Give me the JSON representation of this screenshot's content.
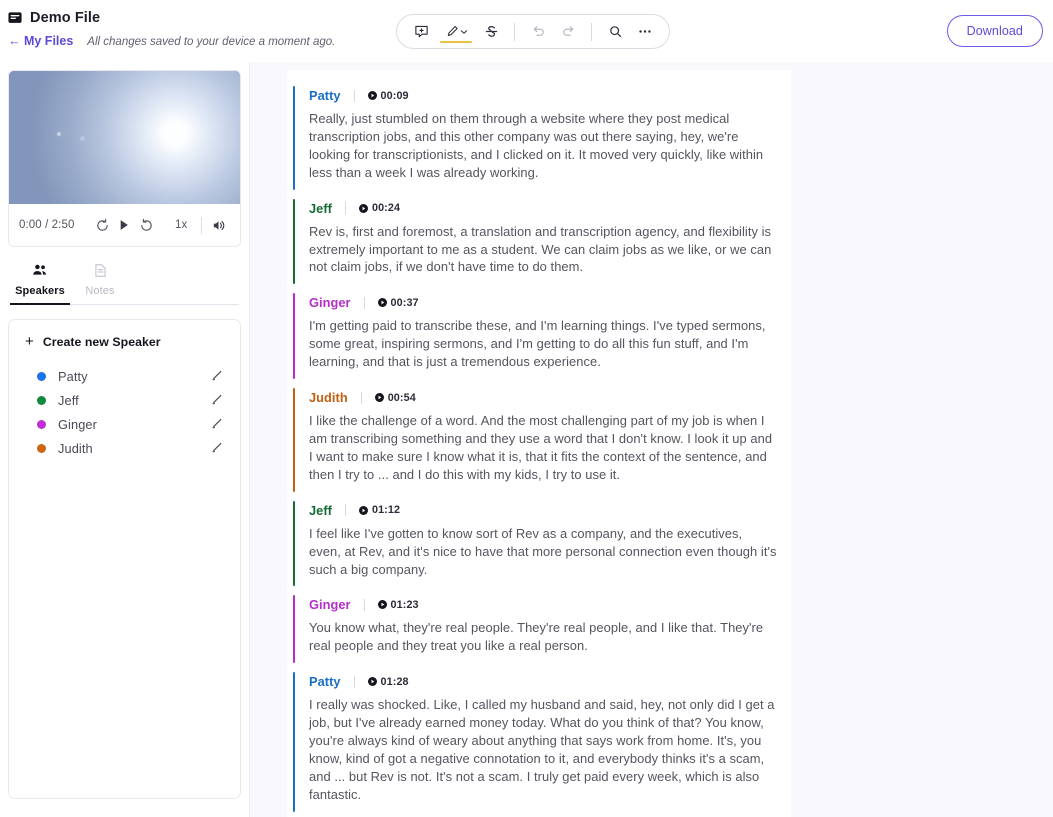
{
  "header": {
    "file_icon": "file-document-icon",
    "title": "Demo File",
    "back_link": "← My Files",
    "saved_note": "All changes saved to your device a moment ago.",
    "download_label": "Download"
  },
  "toolbar": {
    "items": [
      {
        "name": "comment-icon",
        "label": "Comment"
      },
      {
        "name": "highlighter-icon",
        "label": "Highlight"
      },
      {
        "name": "strikethrough-icon",
        "label": "Strikethrough"
      },
      {
        "name": "undo-icon",
        "label": "Undo"
      },
      {
        "name": "redo-icon",
        "label": "Redo"
      },
      {
        "name": "search-icon",
        "label": "Search"
      },
      {
        "name": "more-options-icon",
        "label": "More"
      }
    ],
    "highlight_color": "#e8c33c"
  },
  "player": {
    "current_time": "0:00",
    "total_time": "2:50",
    "time_display": "0:00 / 2:50",
    "speed": "1x",
    "rewind_label": "Rewind 10 seconds",
    "play_label": "Play",
    "forward_label": "Forward 10 seconds",
    "volume_label": "Volume"
  },
  "tabs": [
    {
      "label": "Speakers",
      "icon": "people-icon",
      "active": true
    },
    {
      "label": "Notes",
      "icon": "note-icon",
      "active": false
    }
  ],
  "speakers_panel": {
    "create_label": "Create new Speaker",
    "speakers": [
      {
        "name": "Patty",
        "color": "#1a73e8"
      },
      {
        "name": "Jeff",
        "color": "#12893c"
      },
      {
        "name": "Ginger",
        "color": "#c12ed6"
      },
      {
        "name": "Judith",
        "color": "#cc6611"
      }
    ]
  },
  "transcript": {
    "entries": [
      {
        "speaker": "Patty",
        "color": "#1a6ec4",
        "time": "00:09",
        "text": "Really, just stumbled on them through a website where they post medical transcription jobs, and this other company was out there saying, hey, we're looking for transcriptionists, and I clicked on it. It moved very quickly, like within less than a week I was already working."
      },
      {
        "speaker": "Jeff",
        "color": "#156b33",
        "time": "00:24",
        "text": "Rev is, first and foremost, a translation and transcription agency, and flexibility is extremely important to me as a student. We can claim jobs as we like, or we can not claim jobs, if we don't have time to do them."
      },
      {
        "speaker": "Ginger",
        "color": "#b52ec9",
        "time": "00:37",
        "text": "I'm getting paid to transcribe these, and I'm learning things. I've typed sermons, some great, inspiring sermons, and I'm getting to do all this fun stuff, and I'm learning, and that is just a tremendous experience."
      },
      {
        "speaker": "Judith",
        "color": "#c06010",
        "time": "00:54",
        "text": "I like the challenge of a word. And the most challenging part of my job is when I am transcribing something and they use a word that I don't know. I look it up and I want to make sure I know what it is, that it fits the context of the sentence, and then I try to ... and I do this with my kids, I try to use it."
      },
      {
        "speaker": "Jeff",
        "color": "#156b33",
        "time": "01:12",
        "text": "I feel like I've gotten to know sort of Rev as a company, and the executives, even, at Rev, and it's nice to have that more personal connection even though it's such a big company."
      },
      {
        "speaker": "Ginger",
        "color": "#b52ec9",
        "time": "01:23",
        "text": "You know what, they're real people. They're real people, and I like that. They're real people and they treat you like a real person."
      },
      {
        "speaker": "Patty",
        "color": "#1a6ec4",
        "time": "01:28",
        "text": "I really was shocked. Like, I called my husband and said, hey, not only did I get a job, but I've already earned money today. What do you think of that? You know, you're always kind of weary about anything that says work from home. It's, you know, kind of got a negative connotation to it, and everybody thinks it's a scam, and ... but Rev is not. It's not a scam. I truly get paid every week, which is also fantastic."
      }
    ]
  }
}
